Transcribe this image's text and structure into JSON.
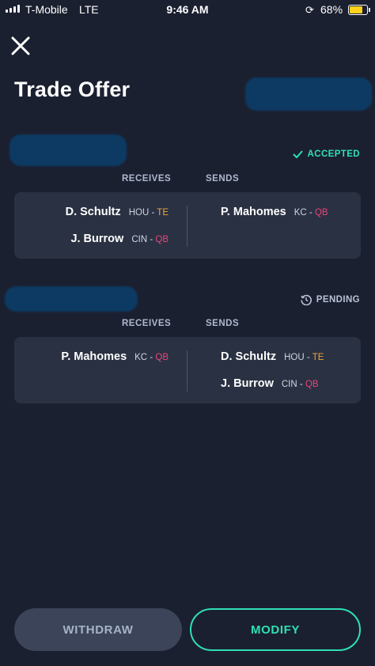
{
  "status_bar": {
    "carrier": "T-Mobile",
    "network": "LTE",
    "time": "9:46 AM",
    "battery_percent": "68%",
    "battery_level": 0.68,
    "battery_color": "#ffd21e"
  },
  "header": {
    "title": "Trade Offer",
    "close_icon": "close-icon"
  },
  "trades": [
    {
      "status_label": "ACCEPTED",
      "status_icon": "checkmark-icon",
      "receives_label": "RECEIVES",
      "sends_label": "SENDS",
      "receives": [
        {
          "name": "D. Schultz",
          "team": "HOU",
          "sep": "-",
          "pos": "TE"
        },
        {
          "name": "J. Burrow",
          "team": "CIN",
          "sep": "-",
          "pos": "QB"
        }
      ],
      "sends": [
        {
          "name": "P. Mahomes",
          "team": "KC",
          "sep": "-",
          "pos": "QB"
        }
      ]
    },
    {
      "status_label": "PENDING",
      "status_icon": "history-clock-icon",
      "receives_label": "RECEIVES",
      "sends_label": "SENDS",
      "receives": [
        {
          "name": "P. Mahomes",
          "team": "KC",
          "sep": "-",
          "pos": "QB"
        }
      ],
      "sends": [
        {
          "name": "D. Schultz",
          "team": "HOU",
          "sep": "-",
          "pos": "TE"
        },
        {
          "name": "J. Burrow",
          "team": "CIN",
          "sep": "-",
          "pos": "QB"
        }
      ]
    }
  ],
  "actions": {
    "withdraw_label": "WITHDRAW",
    "modify_label": "MODIFY"
  },
  "colors": {
    "background": "#1b2030",
    "card": "#2a3142",
    "accent": "#2ee0b3",
    "te_color": "#f2a43a",
    "qb_color": "#e8457a",
    "redaction": "#0d3a63"
  }
}
